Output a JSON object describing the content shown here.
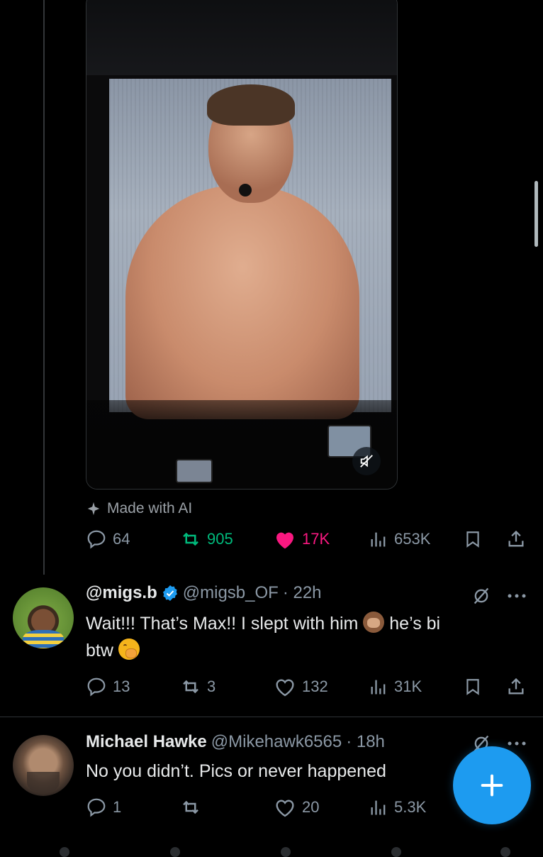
{
  "post": {
    "made_with_label": "Made with AI",
    "stats": {
      "replies": "64",
      "reposts": "905",
      "likes": "17K",
      "views": "653K"
    },
    "colors": {
      "repost": "#00ba7c",
      "like": "#f91880"
    }
  },
  "replies": [
    {
      "display_name": "@migs.b",
      "verified": true,
      "handle": "@migsb_OF",
      "time": "· 22h",
      "text_line1": "Wait!!! That’s Max!! I slept with him",
      "text_after_emoji": "he’s bi",
      "text_line2": "btw",
      "emoji1": "see-no-evil-monkey",
      "emoji2": "face-with-hand-over-mouth",
      "stats": {
        "replies": "13",
        "reposts": "3",
        "likes": "132",
        "views": "31K"
      }
    },
    {
      "display_name": "Michael Hawke",
      "verified": false,
      "handle": "@Mikehawk6565",
      "time": "· 18h",
      "text_line1": "No you didn’t. Pics or never happened",
      "stats": {
        "replies": "1",
        "reposts": "",
        "likes": "20",
        "views": "5.3K"
      }
    }
  ],
  "fab": {
    "icon": "plus-icon",
    "color": "#1d9bf0"
  },
  "theme": {
    "background": "#000000",
    "muted_text": "#8b98a5",
    "verified_badge": "#1d9bf0"
  }
}
